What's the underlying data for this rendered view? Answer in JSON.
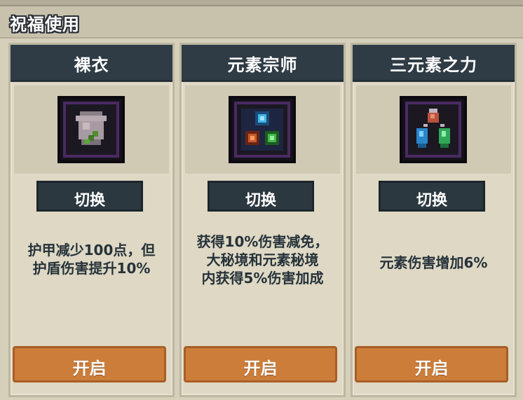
{
  "header": {
    "title": "祝福使用"
  },
  "cards": [
    {
      "title": "裸衣",
      "icon": "armor-icon",
      "switch_label": "切换",
      "description": "护甲减少100点，但\n护盾伤害提升10%",
      "open_label": "开启"
    },
    {
      "title": "元素宗师",
      "icon": "element-master-icon",
      "switch_label": "切换",
      "description": "获得10%伤害减免，\n大秘境和元素秘境\n内获得5%伤害加成",
      "open_label": "开启"
    },
    {
      "title": "三元素之力",
      "icon": "three-elements-icon",
      "switch_label": "切换",
      "description": "元素伤害增加6%",
      "open_label": "开启"
    }
  ],
  "colors": {
    "title_bar": "#2f3c45",
    "button_dark": "#2c3840",
    "button_orange": "#cc7d3a",
    "card_bg": "#ded8c4",
    "icon_border": "#4a2a63"
  }
}
